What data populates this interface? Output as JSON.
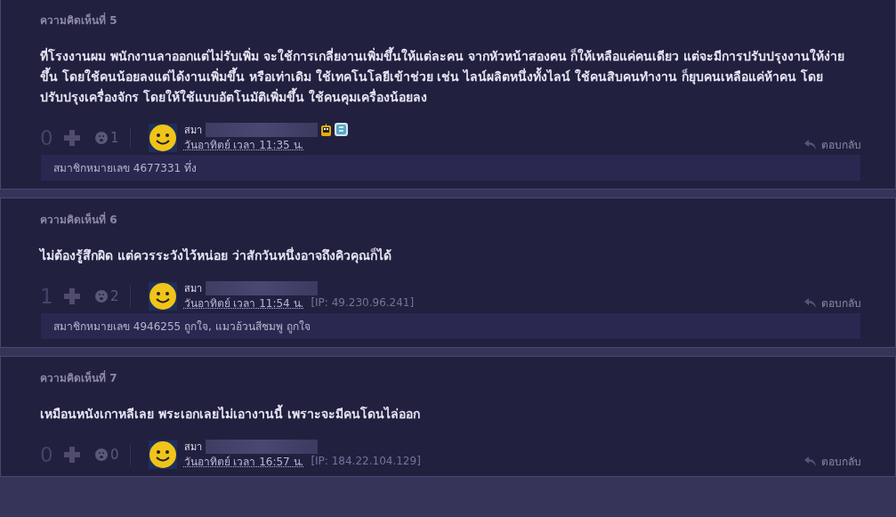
{
  "comments": [
    {
      "label": "ความคิดเห็นที่ 5",
      "text": "ที่โรงงานผม พนักงานลาออกแต่ไม่รับเพิ่ม จะใช้การเกลี่ยงานเพิ่มขึ้นให้แต่ละคน จากหัวหน้าสองคน ก็ให้เหลือแค่คนเดียว แต่จะมีการปรับปรุงงานให้ง่ายขึ้น โดยใช้คนน้อยลงแต่ได้งานเพิ่มขึ้น หรือเท่าเดิม ใช้เทคโนโลยีเข้าช่วย เช่น ไลน์ผลิตหนึ่งทั้งไลน์ ใช้คนสิบคนทำงาน ก็ยุบคนเหลือแค่ห้าคน โดยปรับปรุงเครื่องจักร โดยให้ใช้แบบอัตโนมัติเพิ่มขึ้น ใช้คนคุมเครื่องน้อยลง",
      "votes": "0",
      "emotions": "1",
      "user": "สมา",
      "time": "วันอาทิตย์ เวลา 11:35 น.",
      "badges": true,
      "reply": "ตอบกลับ",
      "likes": "สมาชิกหมายเลข 4677331 ทึ่ง"
    },
    {
      "label": "ความคิดเห็นที่ 6",
      "text": "ไม่ต้องรู้สึกผิด แต่ควรระวังไว้หน่อย ว่าสักวันหนึ่งอาจถึงคิวคุณก็ได้",
      "votes": "1",
      "emotions": "2",
      "user": "สมา",
      "time": "วันอาทิตย์ เวลา 11:54 น.",
      "ip": "[IP: 49.230.96.241]",
      "badges": false,
      "reply": "ตอบกลับ",
      "likes": "สมาชิกหมายเลข 4946255 ถูกใจ, แมวอ้วนสีชมพู ถูกใจ"
    },
    {
      "label": "ความคิดเห็นที่ 7",
      "text": "เหมือนหนังเกาหลีเลย พระเอกเลยไม่เอางานนี้ เพราะจะมีคนโดนไล่ออก",
      "votes": "0",
      "emotions": "0",
      "user": "สมา",
      "time": "วันอาทิตย์ เวลา 16:57 น.",
      "ip": "[IP: 184.22.104.129]",
      "badges": false,
      "reply": "ตอบกลับ"
    }
  ]
}
